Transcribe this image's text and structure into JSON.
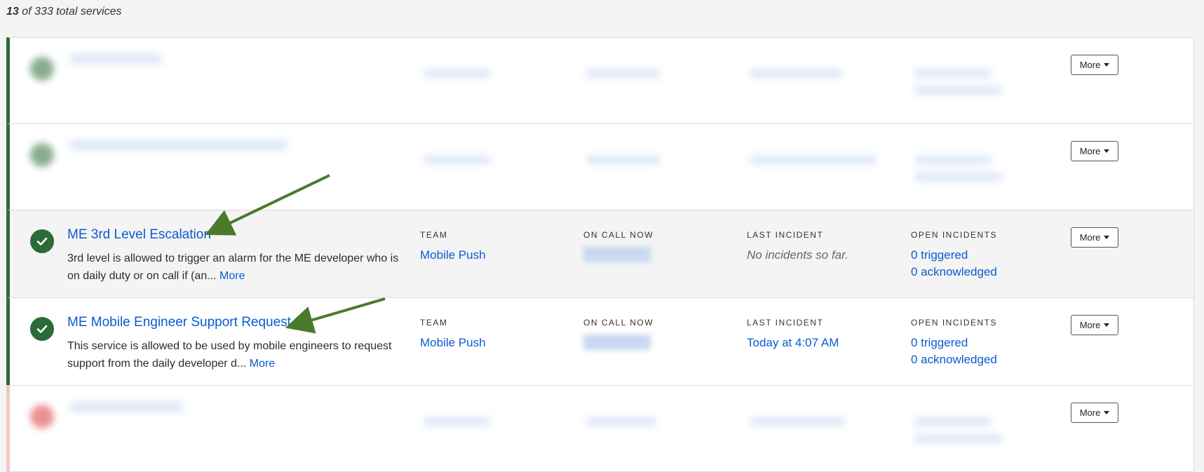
{
  "summary": {
    "count": "13",
    "total_text": " of 333 total services"
  },
  "columns": {
    "team": "TEAM",
    "on_call": "ON CALL NOW",
    "last_incident": "LAST INCIDENT",
    "open_incidents": "OPEN INCIDENTS"
  },
  "rows": [
    {
      "title": "ME 3rd Level Escalation",
      "description": "3rd level is allowed to trigger an alarm for the ME developer who is on daily duty or on call if (an...",
      "more_link": "More",
      "team": "Mobile Push",
      "last_incident": "No incidents so far.",
      "triggered": "0 triggered",
      "acknowledged": "0 acknowledged"
    },
    {
      "title": "ME Mobile Engineer Support Request",
      "description": "This service is allowed to be used by mobile engineers to request support from the daily developer d...",
      "more_link": "More",
      "team": "Mobile Push",
      "last_incident": "Today at 4:07 AM",
      "triggered": "0 triggered",
      "acknowledged": "0 acknowledged"
    }
  ],
  "more_button": "More",
  "colors": {
    "accent": "#0a5bd3",
    "status_ok": "#2a6b38",
    "status_critical": "#d83a3a",
    "arrow": "#4a7a2c"
  }
}
